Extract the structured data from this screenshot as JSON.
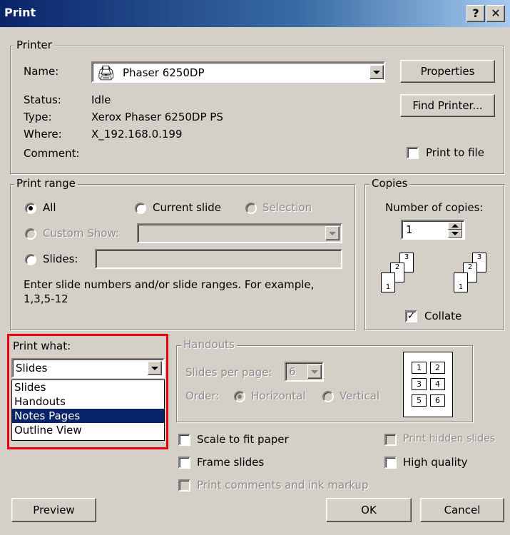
{
  "window": {
    "title": "Print",
    "help_label": "?",
    "close_label": "✕"
  },
  "printer": {
    "legend": "Printer",
    "name_label": "Name:",
    "name_value": "Phaser 6250DP",
    "status_label": "Status:",
    "status_value": "Idle",
    "type_label": "Type:",
    "type_value": "Xerox Phaser 6250DP PS",
    "where_label": "Where:",
    "where_value": "X_192.168.0.199",
    "comment_label": "Comment:",
    "properties_label": "Properties",
    "find_printer_label": "Find Printer...",
    "print_to_file_label": "Print to file",
    "printer_icon": "printer-icon"
  },
  "print_range": {
    "legend": "Print range",
    "all_label": "All",
    "current_slide_label": "Current slide",
    "selection_label": "Selection",
    "custom_show_label": "Custom Show:",
    "slides_label": "Slides:",
    "help_text_1": "Enter slide numbers and/or slide ranges. For example,",
    "help_text_2": "1,3,5-12"
  },
  "copies": {
    "legend": "Copies",
    "number_label": "Number of copies:",
    "number_value": "1",
    "collate_label": "Collate",
    "collate_checked": "✓",
    "collate_pages": [
      "1",
      "2",
      "3",
      "1",
      "2",
      "3"
    ]
  },
  "print_what": {
    "label": "Print what:",
    "selected": "Slides",
    "options": [
      "Slides",
      "Handouts",
      "Notes Pages",
      "Outline View"
    ],
    "highlighted_option": "Notes Pages"
  },
  "handouts": {
    "legend": "Handouts",
    "slides_per_page_label": "Slides per page:",
    "slides_per_page_value": "6",
    "order_label": "Order:",
    "horizontal_label": "Horizontal",
    "vertical_label": "Vertical",
    "preview_numbers": [
      "1",
      "2",
      "3",
      "4",
      "5",
      "6"
    ]
  },
  "options": {
    "scale_to_fit_label": "Scale to fit paper",
    "frame_slides_label": "Frame slides",
    "print_comments_label": "Print comments and ink markup",
    "print_hidden_label": "Print hidden slides",
    "high_quality_label": "High quality"
  },
  "buttons": {
    "preview_label": "Preview",
    "ok_label": "OK",
    "cancel_label": "Cancel"
  },
  "colors": {
    "highlight_box": "#e8000b",
    "selection": "#0a246a",
    "dialog_face": "#d4d0c8"
  }
}
